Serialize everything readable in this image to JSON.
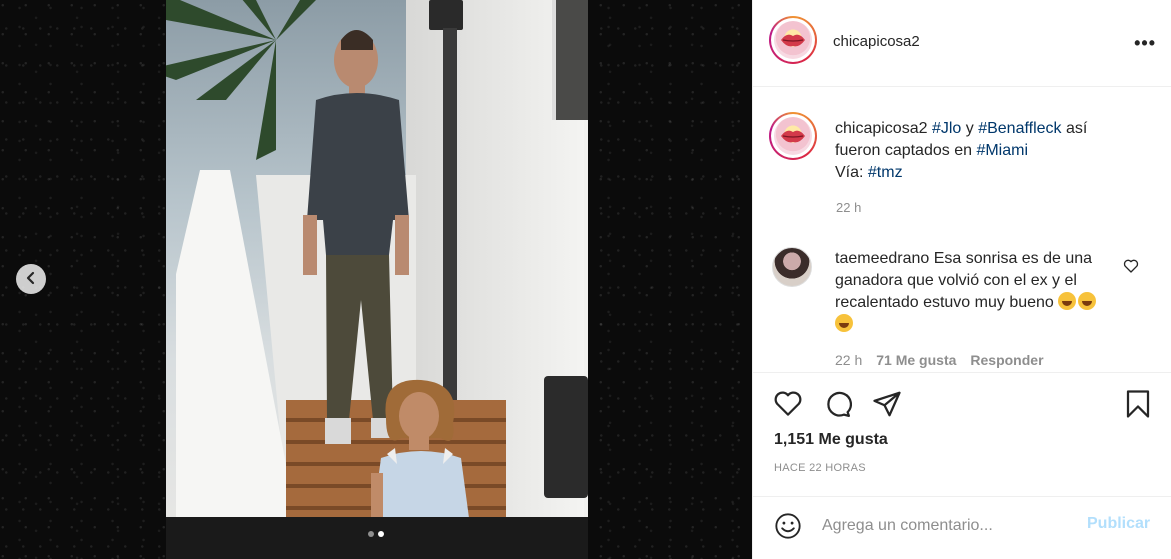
{
  "post": {
    "username": "chicapicosa2",
    "more_label": "•••",
    "caption": {
      "username": "chicapicosa2",
      "tag1": "#Jlo",
      "and": " y ",
      "tag2": "#Benaffleck",
      "text1": " así fueron captados en ",
      "tag3": "#Miami",
      "via": "Vía: ",
      "tag4": "#tmz",
      "time": "22 h"
    },
    "comment": {
      "username": "taemeedrano",
      "text": " Esa sonrisa es de una ganadora que volvió con el ex y el recalentado estuvo muy bueno",
      "time": "22 h",
      "likes": "71 Me gusta",
      "reply": "Responder"
    },
    "likes": "1,151 Me gusta",
    "age": "HACE 22 HORAS",
    "comment_box": {
      "placeholder": "Agrega un comentario...",
      "publish": "Publicar"
    }
  },
  "carousel": {
    "count": 2,
    "active": 2
  },
  "icons": [
    "chevron-left-icon",
    "heart-icon",
    "comment-icon",
    "share-icon",
    "bookmark-icon",
    "emoji-icon"
  ],
  "colors": {
    "link": "#00376b",
    "muted": "#8e8e8e",
    "publish_disabled": "#b2dffc"
  }
}
